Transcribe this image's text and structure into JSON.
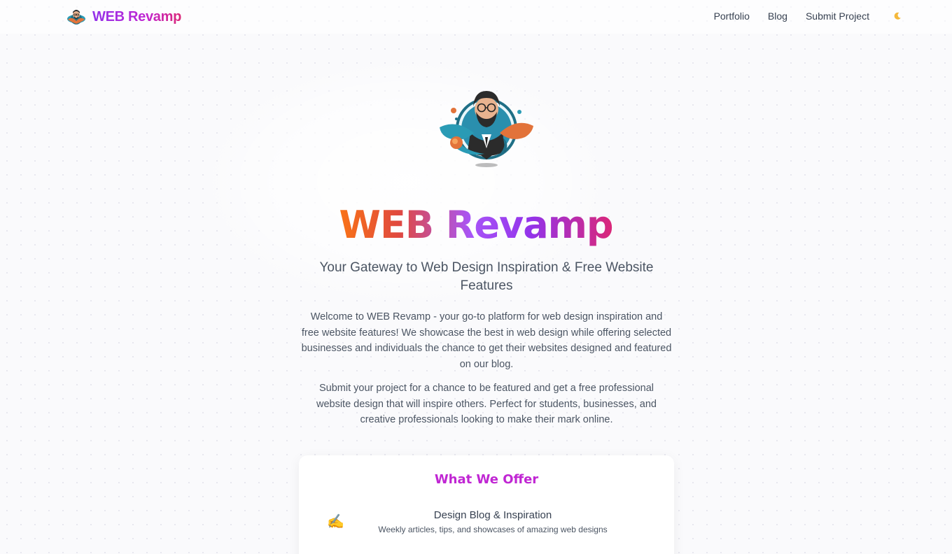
{
  "brand": {
    "name": "WEB Revamp",
    "logo_icon": "developer-avatar-icon"
  },
  "nav": {
    "links": [
      "Portfolio",
      "Blog",
      "Submit Project"
    ],
    "theme_toggle_icon": "crescent-moon-icon"
  },
  "hero": {
    "logo_icon": "developer-avatar-icon",
    "title": "WEB Revamp",
    "tagline": "Your Gateway to Web Design Inspiration & Free Website Features",
    "intro": "Welcome to WEB Revamp - your go-to platform for web design inspiration and free website features! We showcase the best in web design while offering selected businesses and individuals the chance to get their websites designed and featured on our blog.",
    "intro2": "Submit your project for a chance to be featured and get a free professional website design that will inspire others. Perfect for students, businesses, and creative professionals looking to make their mark online."
  },
  "offer": {
    "title": "What We Offer",
    "items": [
      {
        "icon": "✍️",
        "icon_name": "writing-hand-icon",
        "title": "Design Blog & Inspiration",
        "description": "Weekly articles, tips, and showcases of amazing web designs"
      }
    ]
  },
  "colors": {
    "brand_gradient_start": "#9333ea",
    "brand_gradient_end": "#db2777",
    "title_gradient_start": "#f97316",
    "accent": "#c026d3"
  }
}
